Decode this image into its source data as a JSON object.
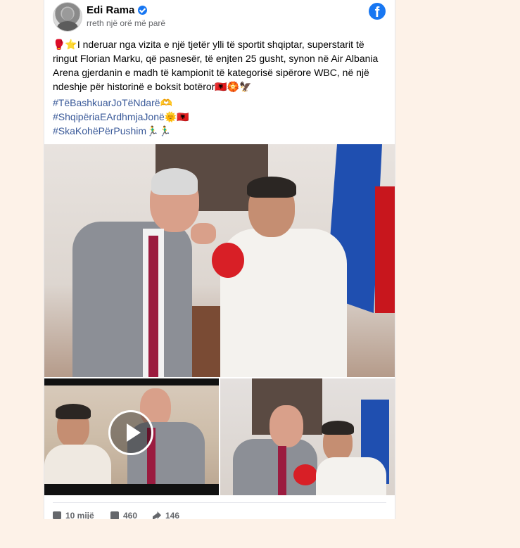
{
  "post": {
    "author": "Edi Rama",
    "timestamp": "rreth një orë më parë",
    "text": "🥊⭐I nderuar nga vizita e një tjetër ylli të sportit shqiptar, superstarit të ringut Florian Marku, që pasnesër, të enjten 25 gusht, synon në Air Albania Arena gjerdanin e madh të kampionit të kategorisë sipërore WBC, në një ndeshje për historinë e boksit botëror🇦🇱🏵️🦅",
    "hashtags": [
      "#TëBashkuarJoTëNdarë🫶",
      "#ShqipëriaEArdhmjaJonë🌞🇦🇱",
      "#SkaKohëPërPushim🏃‍♂️🏃‍♂️"
    ],
    "icons": {
      "platform": "facebook-icon",
      "verified": "verified-badge-icon",
      "play": "play-icon",
      "like": "like-icon",
      "comment": "comment-icon",
      "share": "share-icon"
    },
    "brand_color": "#1877f2",
    "hashtag_color": "#385898"
  },
  "stats": {
    "likes": "10 mijë",
    "comments": "460",
    "shares": "146"
  },
  "facebook_letter": "f"
}
